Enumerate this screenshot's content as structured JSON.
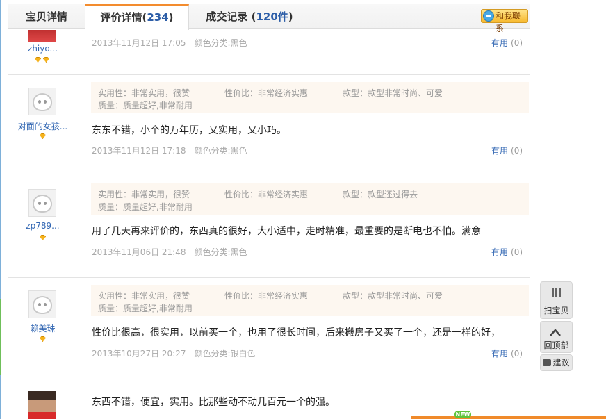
{
  "tabs": [
    {
      "label": "宝贝详情",
      "count": "",
      "suffix": ""
    },
    {
      "label": "评价详情(",
      "count": "234",
      "suffix": ")"
    },
    {
      "label": "成交记录 (",
      "count": "120件",
      "suffix": ")"
    }
  ],
  "contact_label": "和我联系",
  "reviews": [
    {
      "nick": "zhiyo...",
      "tags": {},
      "content": "",
      "date": "2013年11月12日 17:05",
      "color": "颜色分类:黑色",
      "useful_label": "有用",
      "useful_count": "(0)"
    },
    {
      "nick": "对面的女孩...",
      "tags": {
        "practical": "实用性：非常实用，很赞",
        "value": "性价比：非常经济实惠",
        "style": "款型：款型非常时尚、可爱",
        "quality": "质量：质量超好,非常耐用"
      },
      "content": "东东不错，小个的万年历，又实用，又小巧。",
      "date": "2013年11月12日 17:18",
      "color": "颜色分类:黑色",
      "useful_label": "有用",
      "useful_count": "(0)"
    },
    {
      "nick": "zp789...",
      "tags": {
        "practical": "实用性：非常实用，很赞",
        "value": "性价比：非常经济实惠",
        "style": "款型：款型还过得去",
        "quality": "质量：质量超好,非常耐用"
      },
      "content": "用了几天再来评价的，东西真的很好，大小适中，走时精准，最重要的是断电也不怕。满意",
      "date": "2013年11月06日 21:48",
      "color": "颜色分类:黑色",
      "useful_label": "有用",
      "useful_count": "(0)"
    },
    {
      "nick": "赖美珠",
      "tags": {
        "practical": "实用性：非常实用，很赞",
        "value": "性价比：非常经济实惠",
        "style": "款型：款型非常时尚、可爱",
        "quality": "质量：质量超好,非常耐用"
      },
      "content": "性价比很高，很实用，以前买一个，也用了很长时间，后来搬房子又买了一个，还是一样的好，",
      "date": "2013年10月27日 20:27",
      "color": "颜色分类:银白色",
      "useful_label": "有用",
      "useful_count": "(0)"
    },
    {
      "nick": "",
      "tags": {},
      "content": "东西不错，便宜，实用。比那些动不动几百元一个的强。",
      "date": "",
      "color": "",
      "useful_label": "",
      "useful_count": ""
    }
  ],
  "side": {
    "qr_label": "扫宝贝",
    "top_label": "回顶部",
    "feedback_label": "建议"
  },
  "new_badge": "NEW",
  "colors": {
    "accent": "#f38c2e",
    "link": "#3267b3",
    "tag_bg": "#fdf7f0"
  }
}
